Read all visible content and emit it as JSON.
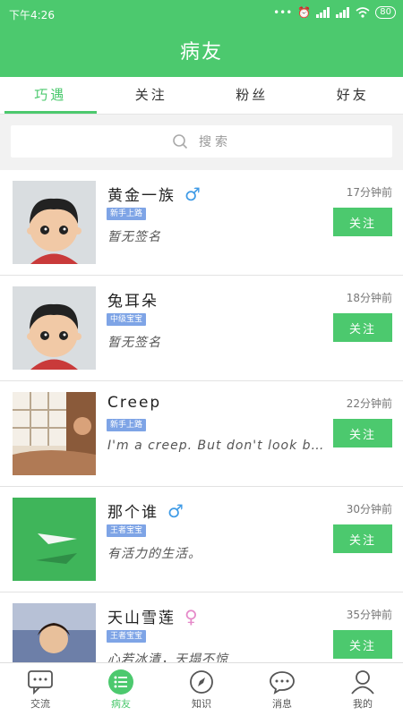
{
  "status_bar": {
    "time": "下午4:26",
    "battery": "80"
  },
  "title": "病友",
  "tabs": [
    "巧遇",
    "关注",
    "粉丝",
    "好友"
  ],
  "search": {
    "placeholder": "搜索"
  },
  "follow_label": "关注",
  "users": [
    {
      "name": "黄金一族",
      "gender": "male",
      "gender_symbol": "♂",
      "badge": "新手上路",
      "signature": "暂无签名",
      "time_ago": "17分钟前",
      "avatar": "cartoon-boy"
    },
    {
      "name": "兔耳朵",
      "gender": "",
      "gender_symbol": "",
      "badge": "中级宝宝",
      "signature": "暂无签名",
      "time_ago": "18分钟前",
      "avatar": "cartoon-boy"
    },
    {
      "name": "Creep",
      "gender": "",
      "gender_symbol": "",
      "badge": "新手上路",
      "signature": "I'm a creep. But don't look b…",
      "time_ago": "22分钟前",
      "avatar": "photo-window"
    },
    {
      "name": "那个谁",
      "gender": "male",
      "gender_symbol": "♂",
      "badge": "王者宝宝",
      "signature": "有活力的生活。",
      "time_ago": "30分钟前",
      "avatar": "paper-plane"
    },
    {
      "name": "天山雪莲",
      "gender": "female",
      "gender_symbol": "♀",
      "badge": "王者宝宝",
      "signature": "心若冰清，天塌不惊",
      "time_ago": "35分钟前",
      "avatar": "photo-woman"
    }
  ],
  "bottom_nav": [
    {
      "label": "交流",
      "icon": "chat-icon"
    },
    {
      "label": "病友",
      "icon": "list-icon",
      "active": true
    },
    {
      "label": "知识",
      "icon": "compass-icon"
    },
    {
      "label": "消息",
      "icon": "message-icon"
    },
    {
      "label": "我的",
      "icon": "person-icon"
    }
  ],
  "colors": {
    "accent": "#4cc96e",
    "badge": "#7ea4e6",
    "male": "#3f9be6",
    "female": "#e58ac9"
  }
}
